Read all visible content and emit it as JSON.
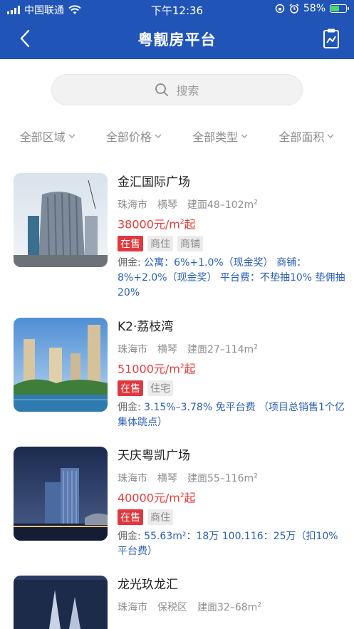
{
  "status": {
    "carrier": "中国联通",
    "time": "下午12:36",
    "battery": "58%",
    "battery_level": 0.58
  },
  "navbar": {
    "title": "粤靓房平台"
  },
  "search": {
    "placeholder": "搜索"
  },
  "filters": [
    "全部区域",
    "全部价格",
    "全部类型",
    "全部面积"
  ],
  "listings": [
    {
      "name": "金汇国际广场",
      "city": "珠海市",
      "district": "横琴",
      "area": "建面48–102m",
      "price": "38000元/m",
      "price_suffix": "起",
      "status_tag": "在售",
      "tags": [
        "商住",
        "商铺"
      ],
      "commission_label": "佣金:",
      "commission": "公寓：6%+1.0%（现金奖） 商铺：8%+2.0%（现金奖） 平台费：不垫抽10% 垫佣抽20%"
    },
    {
      "name": "K2·荔枝湾",
      "city": "珠海市",
      "district": "横琴",
      "area": "建面27–114m",
      "price": "51000元/m",
      "price_suffix": "起",
      "status_tag": "在售",
      "tags": [
        "住宅"
      ],
      "commission_label": "佣金:",
      "commission": "3.15%–3.78% 免平台费 （项目总销售1个亿集体跳点）"
    },
    {
      "name": "天庆粤凯广场",
      "city": "珠海市",
      "district": "横琴",
      "area": "建面55–116m",
      "price": "40000元/m",
      "price_suffix": "起",
      "status_tag": "在售",
      "tags": [
        "商住"
      ],
      "commission_label": "佣金:",
      "commission": "55.63m²：18万 100.116：25万（扣10%平台费）"
    },
    {
      "name": "龙光玖龙汇",
      "city": "珠海市",
      "district": "保税区",
      "area": "建面32–68m"
    }
  ]
}
